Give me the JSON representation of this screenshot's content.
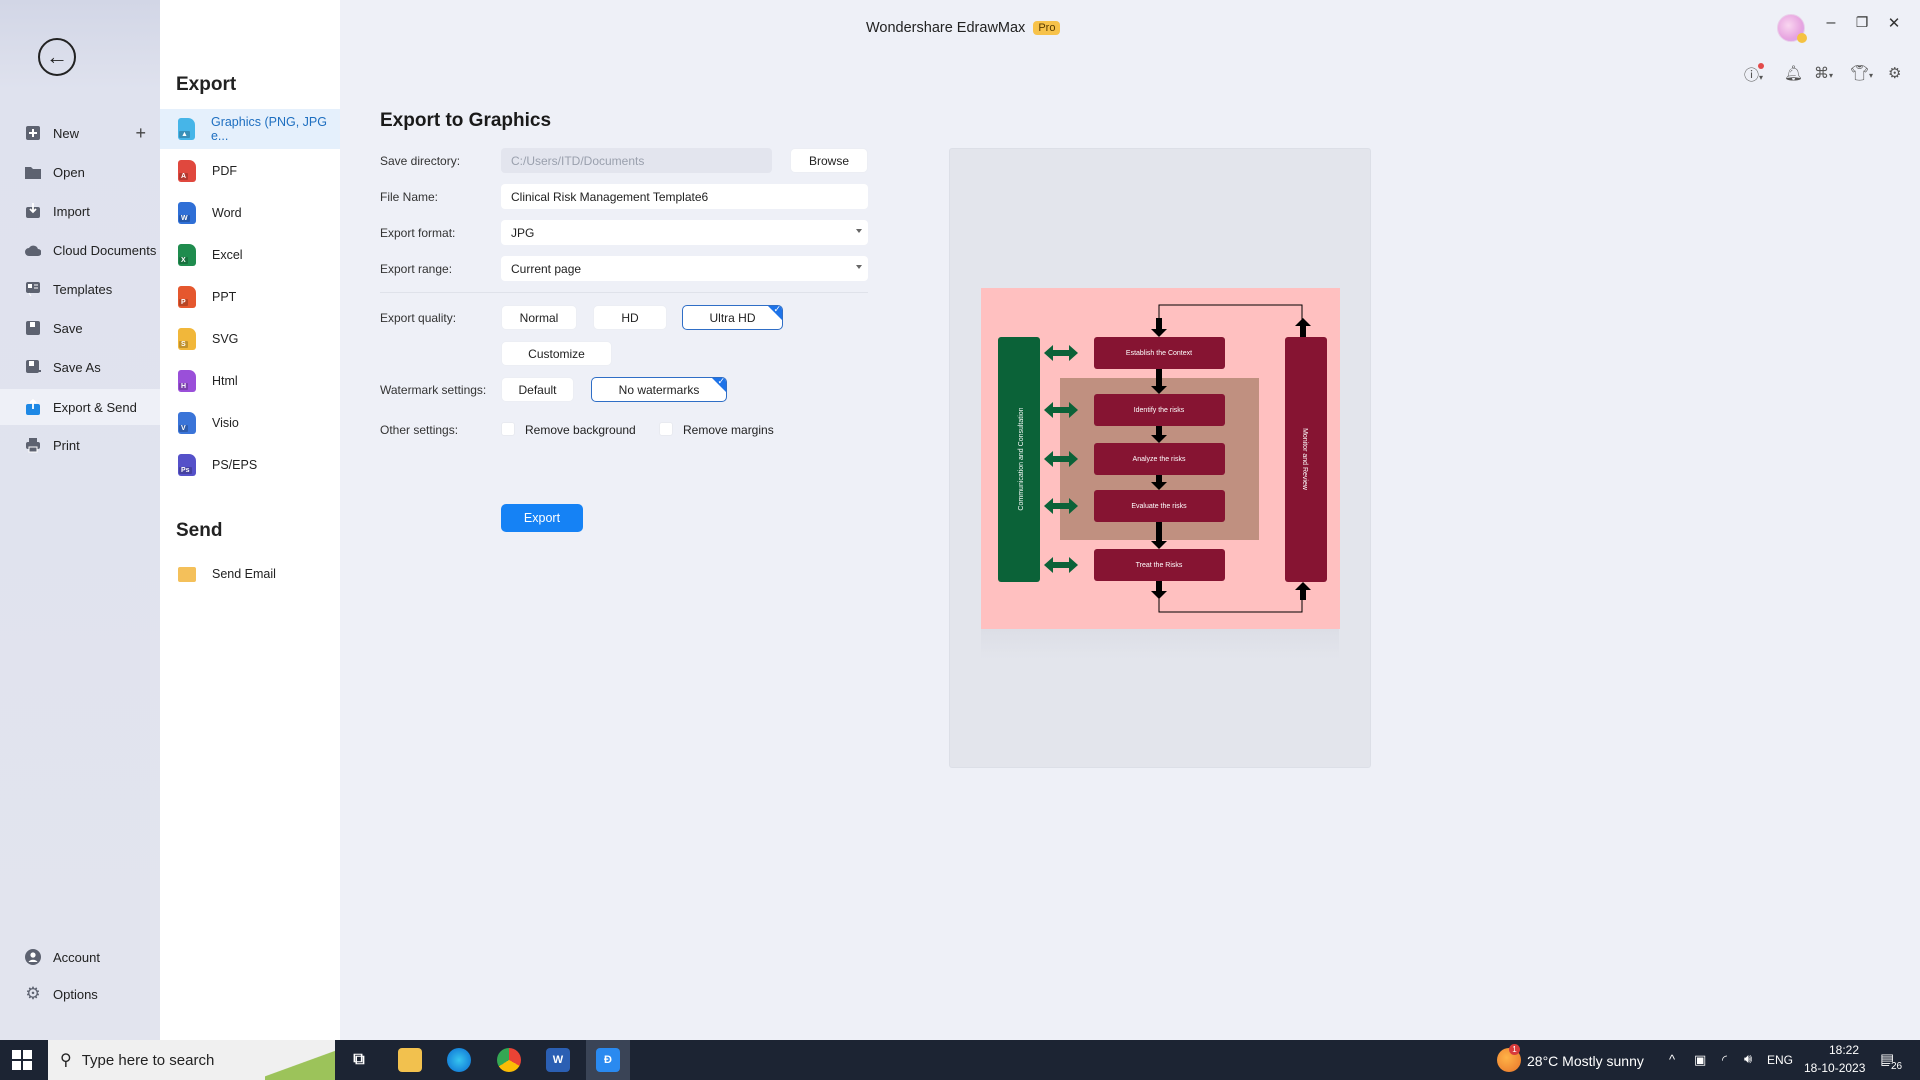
{
  "window": {
    "title": "Wondershare EdrawMax",
    "badge": "Pro",
    "controls": {
      "minimize": "–",
      "restore": "❐",
      "close": "✕"
    }
  },
  "toolbar_icons": [
    "help-icon",
    "bell-icon",
    "apps-icon",
    "shirt-icon",
    "settings-icon"
  ],
  "sidebar": {
    "items": [
      {
        "label": "New",
        "icon": "new-icon"
      },
      {
        "label": "Open",
        "icon": "folder-icon"
      },
      {
        "label": "Import",
        "icon": "import-icon"
      },
      {
        "label": "Cloud Documents",
        "icon": "cloud-icon"
      },
      {
        "label": "Templates",
        "icon": "templates-icon"
      },
      {
        "label": "Save",
        "icon": "save-icon"
      },
      {
        "label": "Save As",
        "icon": "save-as-icon"
      },
      {
        "label": "Export & Send",
        "icon": "export-icon",
        "active": true
      },
      {
        "label": "Print",
        "icon": "print-icon"
      }
    ],
    "bottom": [
      {
        "label": "Account",
        "icon": "account-icon"
      },
      {
        "label": "Options",
        "icon": "gear-icon"
      }
    ]
  },
  "export_panel": {
    "export_heading": "Export",
    "formats": [
      {
        "label": "Graphics (PNG, JPG e...",
        "color": "#46b5e8",
        "tag": "▲",
        "active": true
      },
      {
        "label": "PDF",
        "color": "#e0483e",
        "tag": "A"
      },
      {
        "label": "Word",
        "color": "#2f6fd6",
        "tag": "W"
      },
      {
        "label": "Excel",
        "color": "#1f8c4e",
        "tag": "X"
      },
      {
        "label": "PPT",
        "color": "#e5572e",
        "tag": "P"
      },
      {
        "label": "SVG",
        "color": "#f1b73a",
        "tag": "S"
      },
      {
        "label": "Html",
        "color": "#9a4fd9",
        "tag": "H"
      },
      {
        "label": "Visio",
        "color": "#3a74d8",
        "tag": "V"
      },
      {
        "label": "PS/EPS",
        "color": "#5551c9",
        "tag": "Ps"
      }
    ],
    "send_heading": "Send",
    "send_items": [
      {
        "label": "Send Email",
        "color": "#f4c05a"
      }
    ]
  },
  "form": {
    "title": "Export to Graphics",
    "save_directory": {
      "label": "Save directory:",
      "value": "C:/Users/ITD/Documents",
      "browse": "Browse"
    },
    "file_name": {
      "label": "File Name:",
      "value": "Clinical Risk Management Template6"
    },
    "export_format": {
      "label": "Export format:",
      "value": "JPG"
    },
    "export_range": {
      "label": "Export range:",
      "value": "Current page"
    },
    "export_quality": {
      "label": "Export quality:",
      "options": [
        "Normal",
        "HD",
        "Ultra HD"
      ],
      "selected": "Ultra HD",
      "customize": "Customize"
    },
    "watermark": {
      "label": "Watermark settings:",
      "options": [
        "Default",
        "No watermarks"
      ],
      "selected": "No watermarks"
    },
    "other": {
      "label": "Other settings:",
      "remove_background": "Remove background",
      "remove_margins": "Remove margins",
      "remove_background_checked": false,
      "remove_margins_checked": false
    },
    "export_button": "Export"
  },
  "preview": {
    "left_bar": "Communication and Consultation",
    "right_bar": "Monitor and Review",
    "steps": [
      "Establish the Context",
      "Identify the risks",
      "Analyze the risks",
      "Evaluate the risks",
      "Treat the Risks"
    ],
    "colors": {
      "background": "#ffc0c0",
      "step": "#861432",
      "left_bar": "#0b6238",
      "inner": "#c09080"
    }
  },
  "taskbar": {
    "search_placeholder": "Type here to search",
    "weather": "28°C  Mostly sunny",
    "weather_badge": "1",
    "lang": "ENG",
    "time": "18:22",
    "date": "18-10-2023",
    "notifications": "26"
  }
}
